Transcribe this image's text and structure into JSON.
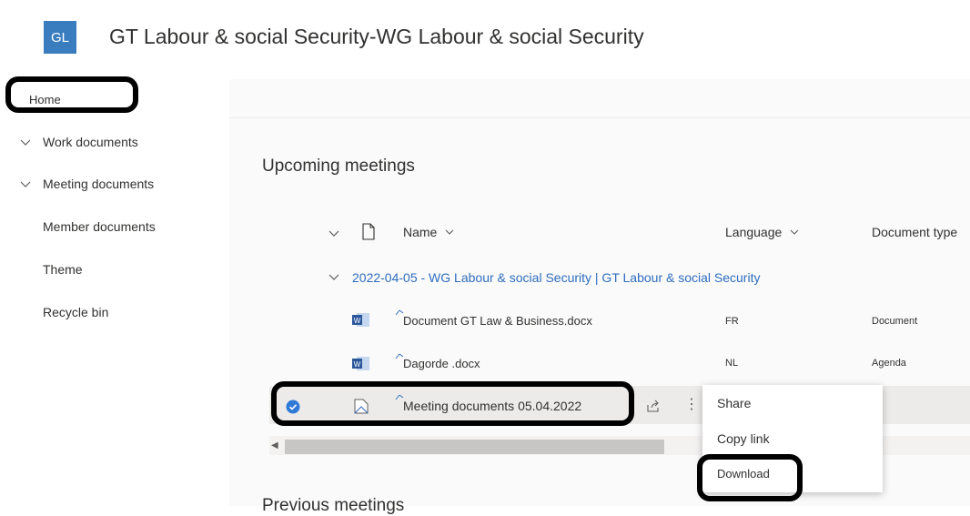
{
  "header": {
    "logo_text": "GL",
    "site_title": "GT Labour & social Security-WG Labour & social Security",
    "accent": "#3a7dbf"
  },
  "nav": {
    "home": "Home",
    "items": [
      {
        "label": "Work documents",
        "expandable": true
      },
      {
        "label": "Meeting documents",
        "expandable": true
      },
      {
        "label": "Member documents",
        "expandable": false
      },
      {
        "label": "Theme",
        "expandable": false
      },
      {
        "label": "Recycle bin",
        "expandable": false
      }
    ]
  },
  "main": {
    "section_title": "Upcoming meetings",
    "next_section_title": "Previous meetings",
    "columns": {
      "name": "Name",
      "language": "Language",
      "doctype": "Document type"
    },
    "group_label": "2022-04-05 - WG Labour & social Security | GT Labour & social Security",
    "rows": [
      {
        "name": "Document GT Law & Business.docx",
        "language": "FR",
        "doctype": "Document",
        "icon": "word-icon"
      },
      {
        "name": "Dagorde .docx",
        "language": "NL",
        "doctype": "Agenda",
        "icon": "word-icon"
      },
      {
        "name": "Meeting documents 05.04.2022",
        "language": "",
        "doctype": "",
        "icon": "document-set-icon",
        "selected": true
      }
    ]
  },
  "context_menu": {
    "share": "Share",
    "copy_link": "Copy link",
    "download": "Download"
  }
}
